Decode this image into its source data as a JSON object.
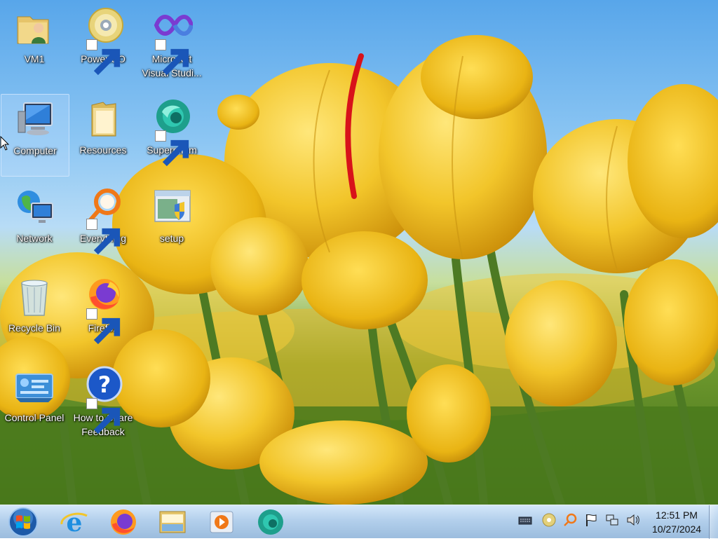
{
  "desktop": {
    "icons": [
      {
        "id": "vm1",
        "label": "VM1"
      },
      {
        "id": "poweriso",
        "label": "PowerISO"
      },
      {
        "id": "vstudio",
        "label": "Microsoft Visual Studi..."
      },
      {
        "id": "computer",
        "label": "Computer"
      },
      {
        "id": "resources",
        "label": "Resources"
      },
      {
        "id": "supermium",
        "label": "Supermium"
      },
      {
        "id": "network",
        "label": "Network"
      },
      {
        "id": "everything",
        "label": "Everything"
      },
      {
        "id": "setup",
        "label": "setup"
      },
      {
        "id": "recycle",
        "label": "Recycle Bin"
      },
      {
        "id": "firefox",
        "label": "Firefox"
      },
      {
        "id": "controlpanel",
        "label": "Control Panel"
      },
      {
        "id": "feedback",
        "label": "How to Share Feedback"
      }
    ]
  },
  "taskbar": {
    "pinned": [
      "internet-explorer-icon",
      "firefox-icon",
      "file-explorer-icon",
      "media-player-icon",
      "supermium-icon"
    ],
    "tray_icons": [
      "keyboard-icon",
      "dvd-icon",
      "everything-search-icon",
      "action-center-flag-icon",
      "network-icon",
      "volume-icon"
    ],
    "clock": {
      "time": "12:51 PM",
      "date": "10/27/2024"
    }
  },
  "colors": {
    "sky": "#58a6ea",
    "tulip": "#f2c52a",
    "stem": "#4d7a23",
    "taskbar": "#b0cde8"
  }
}
